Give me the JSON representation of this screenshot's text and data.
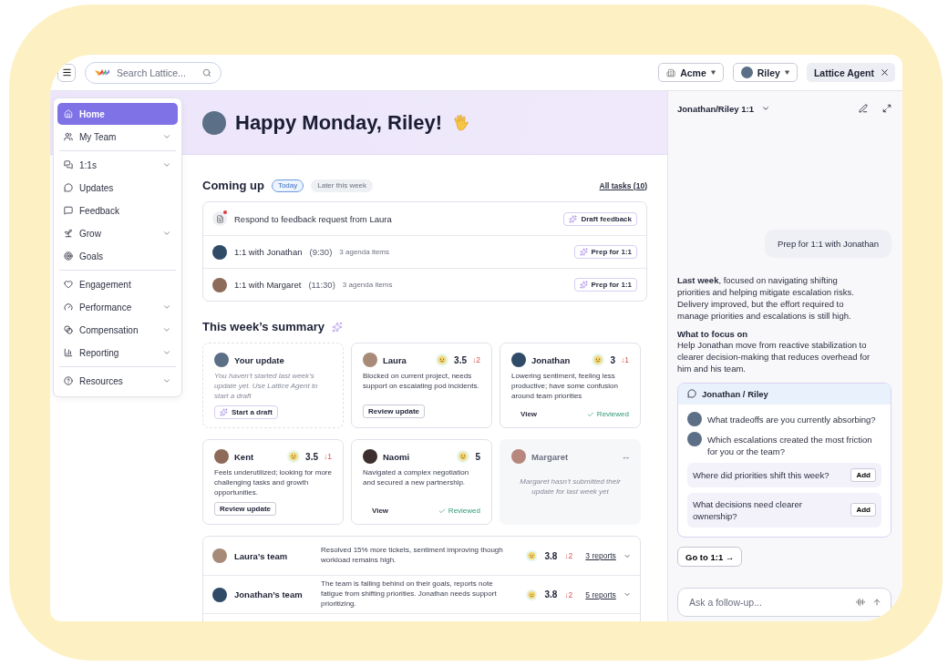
{
  "topbar": {
    "search": {
      "placeholder": "Search Lattice..."
    },
    "org": "Acme",
    "user": "Riley",
    "agent_tab": "Lattice Agent"
  },
  "sidebar": {
    "sections": [
      {
        "items": [
          {
            "label": "Home",
            "selected": true,
            "submenu": false
          },
          {
            "label": "My Team",
            "selected": false,
            "submenu": true
          }
        ]
      },
      {
        "items": [
          {
            "label": "1:1s",
            "selected": false,
            "submenu": true
          },
          {
            "label": "Updates",
            "selected": false,
            "submenu": false
          },
          {
            "label": "Feedback",
            "selected": false,
            "submenu": false
          },
          {
            "label": "Grow",
            "selected": false,
            "submenu": true
          },
          {
            "label": "Goals",
            "selected": false,
            "submenu": false
          }
        ]
      },
      {
        "items": [
          {
            "label": "Engagement",
            "selected": false,
            "submenu": false
          },
          {
            "label": "Performance",
            "selected": false,
            "submenu": true
          },
          {
            "label": "Compensation",
            "selected": false,
            "submenu": true
          },
          {
            "label": "Reporting",
            "selected": false,
            "submenu": true
          }
        ]
      },
      {
        "items": [
          {
            "label": "Resources",
            "selected": false,
            "submenu": true
          }
        ]
      }
    ]
  },
  "greeting": "Happy Monday, Riley!",
  "coming_up": {
    "title": "Coming up",
    "filters": [
      {
        "label": "Today",
        "selected": true
      },
      {
        "label": "Later this week",
        "selected": false
      }
    ],
    "all_tasks": "All tasks (10)",
    "tasks": [
      {
        "kind": "feedback",
        "title": "Respond to feedback request from Laura",
        "action": "Draft feedback"
      },
      {
        "kind": "meeting",
        "title": "1:1 with Jonathan",
        "time": "(9:30)",
        "meta": "3 agenda items",
        "action": "Prep for 1:1"
      },
      {
        "kind": "meeting",
        "title": "1:1 with Margaret",
        "time": "(11:30)",
        "meta": "3 agenda items",
        "action": "Prep for 1:1"
      }
    ]
  },
  "summary": {
    "title": "This week’s summary",
    "cards": [
      {
        "kind": "self",
        "name": "Your update",
        "text": "You haven’t started last week’s update yet. Use Lattice Agent to start a draft",
        "action": "Start a draft"
      },
      {
        "kind": "report",
        "name": "Laura",
        "score": "3.5",
        "delta": "↓2",
        "text": "Blocked on current project, needs support on escalating pod incidents.",
        "action": "Review update",
        "reviewed": false
      },
      {
        "kind": "report",
        "name": "Jonathan",
        "score": "3",
        "delta": "↓1",
        "text": "Lowering sentiment, feeling less productive; have some confusion around team priorities",
        "action": "View",
        "reviewed": true,
        "status": "Reviewed"
      },
      {
        "kind": "report",
        "name": "Kent",
        "score": "3.5",
        "delta": "↓1",
        "text": "Feels underutilized; looking for more challenging tasks and growth opportunities.",
        "action": "Review update",
        "reviewed": false
      },
      {
        "kind": "report",
        "name": "Naomi",
        "score": "5",
        "text": "Navigated a complex negotiation and secured a new partnership.",
        "action": "View",
        "reviewed": true,
        "status": "Reviewed"
      },
      {
        "kind": "pending",
        "name": "Margaret",
        "score": "--",
        "text": "Margaret hasn’t submitted their update for last week yet"
      }
    ],
    "teams": [
      {
        "name": "Laura’s team",
        "text": "Resolved 15% more tickets, sentiment improving though workload remains high.",
        "score": "3.8",
        "delta": "↓2",
        "reports": "3 reports"
      },
      {
        "name": "Jonathan’s team",
        "text": "The team is falling behind on their goals, reports note fatigue from shifting priorities. Jonathan needs support prioritizing.",
        "score": "3.8",
        "delta": "↓2",
        "reports": "5 reports"
      }
    ]
  },
  "agent": {
    "title": "Jonathan/Riley 1:1",
    "prompt": "Prep for 1:1 with Jonathan",
    "response": [
      "**Last week**, focused on navigating shifting priorities and helping mitigate escalation risks. Delivery improved, but the effort required to manage priorities and escalations is still high."
    ],
    "focus_heading": "What to focus on",
    "focus_text": "Help Jonathan move from reactive stabilization to clearer decision-making that reduces overhead for him and his team.",
    "card": {
      "title": "Jonathan / Riley",
      "questions": [
        "What tradeoffs are you currently absorbing?",
        "Which escalations created the most friction for you or the team?"
      ],
      "suggestions": [
        {
          "text": "Where did priorities shift this week?",
          "action": "Add"
        },
        {
          "text": "What decisions need clearer ownership?",
          "action": "Add"
        }
      ]
    },
    "goto": "Go to 1:1 →",
    "input": {
      "placeholder": "Ask a follow-up..."
    }
  }
}
